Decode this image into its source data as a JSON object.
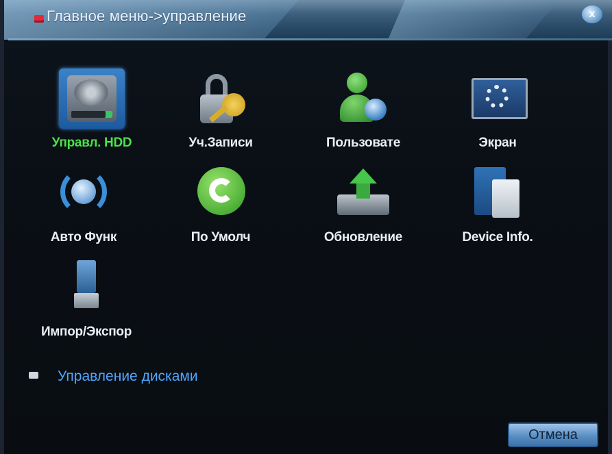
{
  "window": {
    "title": "Главное меню->управление",
    "close_label": "x"
  },
  "tiles": [
    {
      "label": "Управл. HDD",
      "icon": "hdd-icon",
      "selected": true
    },
    {
      "label": "Уч.Записи",
      "icon": "lock-key-icon"
    },
    {
      "label": "Пользовате",
      "icon": "user-icon"
    },
    {
      "label": "Экран",
      "icon": "display-gear-icon"
    },
    {
      "label": "Авто Функ",
      "icon": "auto-maintain-icon"
    },
    {
      "label": "По Умолч",
      "icon": "reset-default-icon"
    },
    {
      "label": "Обновление",
      "icon": "upgrade-icon"
    },
    {
      "label": "Device Info.",
      "icon": "device-info-icon"
    },
    {
      "label": "Импор/Экспор",
      "icon": "usb-import-export-icon"
    }
  ],
  "status": {
    "text": "Управление дисками",
    "icon": "disk-icon"
  },
  "footer": {
    "cancel_label": "Отмена"
  },
  "colors": {
    "selected_label": "#4be24a",
    "status_text": "#4fa6ff",
    "title_icon": "#e22a3a"
  }
}
